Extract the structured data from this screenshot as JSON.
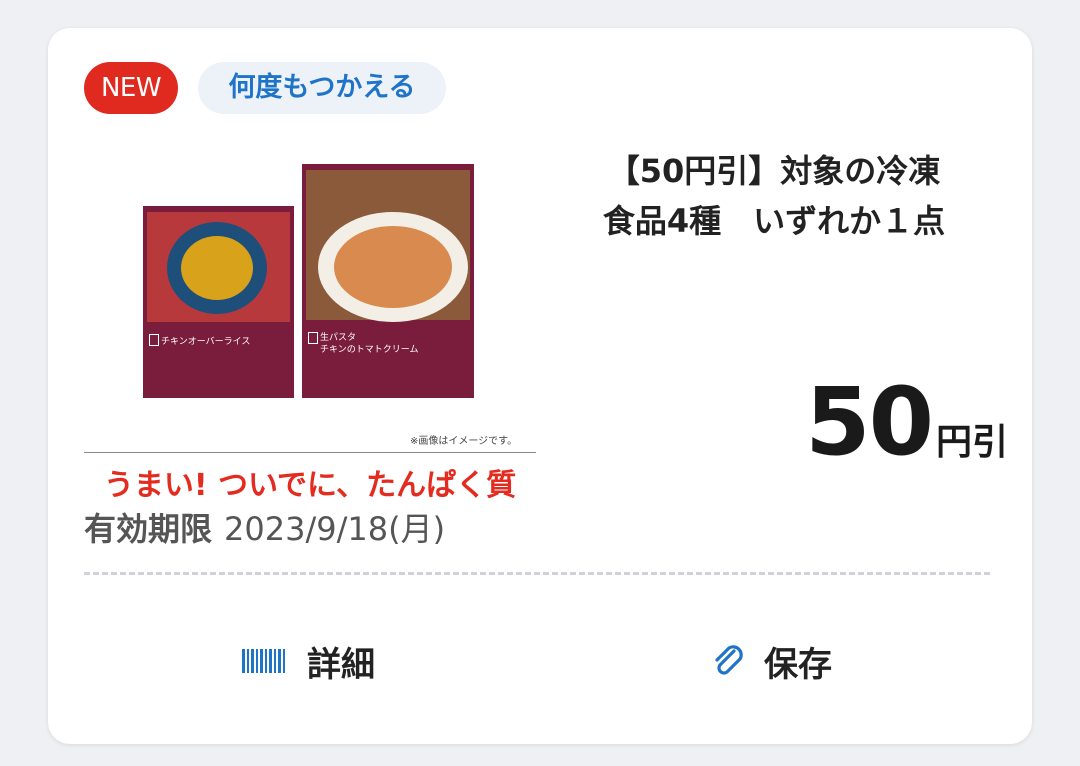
{
  "badges": {
    "new": "NEW",
    "multi_use": "何度もつかえる"
  },
  "product_image": {
    "package1_name": "チキンオーバーライス",
    "package2_line1": "生パスタ",
    "package2_line2": "チキンのトマトクリーム",
    "image_note": "※画像はイメージです。",
    "tagline": "うまい! ついでに、たんぱく質"
  },
  "coupon": {
    "title_line1": "【50円引】対象の冷凍",
    "title_line2": "食品4種　いずれか１点",
    "discount_value": "50",
    "discount_unit": "円引"
  },
  "expiry": {
    "label": "有効期限",
    "date": "2023/9/18(月)"
  },
  "actions": {
    "detail_label": "詳細",
    "save_label": "保存"
  },
  "colors": {
    "new_badge": "#e02a20",
    "accent_blue": "#1f73c8",
    "tagline_red": "#e32b1f",
    "package": "#7a1d3c"
  },
  "icons": {
    "detail": "barcode-icon",
    "save": "paperclip-icon"
  }
}
